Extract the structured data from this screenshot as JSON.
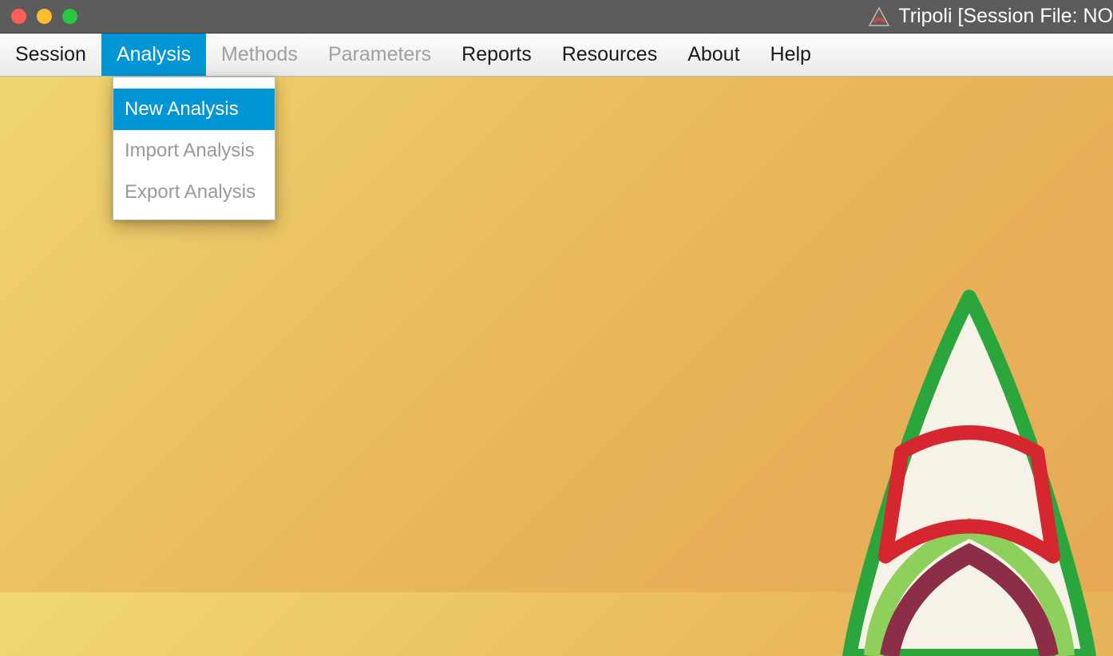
{
  "window": {
    "title": "Tripoli  [Session File: NO"
  },
  "menubar": {
    "items": [
      {
        "label": "Session",
        "state": "enabled"
      },
      {
        "label": "Analysis",
        "state": "active"
      },
      {
        "label": "Methods",
        "state": "disabled"
      },
      {
        "label": "Parameters",
        "state": "disabled"
      },
      {
        "label": "Reports",
        "state": "enabled"
      },
      {
        "label": "Resources",
        "state": "enabled"
      },
      {
        "label": "About",
        "state": "enabled"
      },
      {
        "label": "Help",
        "state": "enabled"
      }
    ]
  },
  "dropdown": {
    "items": [
      {
        "label": "New Analysis",
        "state": "active"
      },
      {
        "label": "Import Analysis",
        "state": "disabled"
      },
      {
        "label": "Export Analysis",
        "state": "disabled"
      }
    ]
  }
}
